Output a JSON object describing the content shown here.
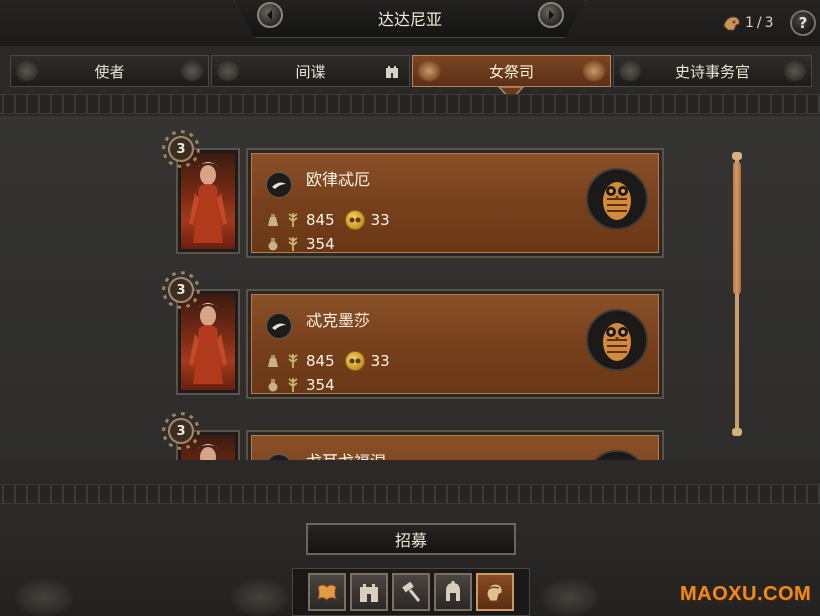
{
  "header": {
    "title": "达达尼亚",
    "page_current": "1",
    "page_separator": "/",
    "page_total": "3",
    "help_label": "?"
  },
  "tabs": [
    {
      "label": "使者",
      "active": false
    },
    {
      "label": "间谍",
      "active": false
    },
    {
      "label": "女祭司",
      "active": true
    },
    {
      "label": "史诗事务官",
      "active": false
    }
  ],
  "agents": [
    {
      "rank": "3",
      "name": "欧律忒厄",
      "stat_primary": "845",
      "stat_gold": "33",
      "stat_secondary": "354"
    },
    {
      "rank": "3",
      "name": "忒克墨莎",
      "stat_primary": "845",
      "stat_gold": "33",
      "stat_secondary": "354"
    },
    {
      "rank": "3",
      "name": "戈耳戈福涅",
      "stat_primary": "",
      "stat_gold": "",
      "stat_secondary": ""
    }
  ],
  "scroll": {
    "position_fraction": 0.0,
    "visible_fraction": 0.5
  },
  "actions": {
    "recruit_label": "招募"
  },
  "bottom_bar": [
    {
      "icon": "map-icon",
      "active": false
    },
    {
      "icon": "fortress-icon",
      "active": false
    },
    {
      "icon": "hammer-icon",
      "active": false
    },
    {
      "icon": "helmet-icon",
      "active": false
    },
    {
      "icon": "agent-head-icon",
      "active": true
    }
  ],
  "watermark": "MAOXU.COM",
  "colors": {
    "accent": "#7a4524",
    "card": "#7a431e",
    "gold": "#d8a83a",
    "watermark": "#f08a1a"
  }
}
